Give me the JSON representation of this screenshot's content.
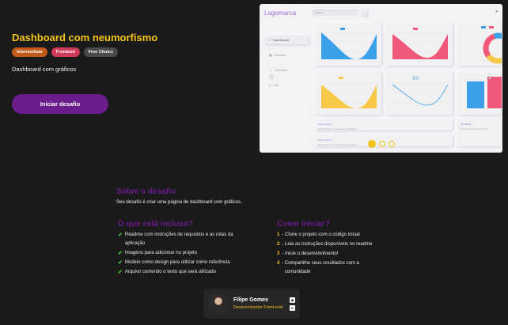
{
  "hero": {
    "title": "Dashboard com neumorfismo",
    "tags": [
      "Intermediate",
      "Frontend",
      "Free Choice"
    ],
    "subtitle": "Dashboard com gráficos",
    "cta_label": "Iniciar desafio"
  },
  "preview": {
    "logo": "Logomarca",
    "search_placeholder": "Search",
    "sidebar": [
      "Dashboard",
      "Produto",
      "Usuários",
      "Fila"
    ],
    "text_cards": [
      {
        "title": "Lorem ipsum",
        "body": "Dolor sit amet consectetur adipiscing"
      },
      {
        "title": "Lorem ipsum",
        "body": "Dolor sit amet consectetur adipiscing"
      },
      {
        "title": "10 000,00",
        "body": "Dolor sit amet consectetur"
      }
    ],
    "carousel_dots": 3,
    "active_dot": 0
  },
  "about": {
    "title": "Sobre o desafio",
    "text": "Seu desafio é criar uma página de dashboard com gráficos."
  },
  "included": {
    "title": "O que está incluso?",
    "items": [
      "Readme com instruções de requisitos e as rotas da aplicação",
      "Imagens para adicionar no projeto",
      "Modelo como design para utilizar como referência",
      "Arquivo contendo o texto que será utilizado"
    ]
  },
  "start": {
    "title": "Como iniciar?",
    "steps": [
      {
        "n": "1",
        "text": "Clone o projeto com o código inicial"
      },
      {
        "n": "2",
        "text": "Leia as instruções disponíveis no readme"
      },
      {
        "n": "3",
        "text": "Inicie o desenvolvimento!"
      },
      {
        "n": "4",
        "text": "Compartilhe seus resultados com a comunidade"
      }
    ]
  },
  "author": {
    "name": "Filipe Gomes",
    "role": "Desenvolvedor Front-end"
  },
  "colors": {
    "accent_yellow": "#f5c518",
    "purple": "#6a1b8c",
    "check_green": "#4ec04e",
    "chart_blue": "#3aa0e8",
    "chart_pink": "#f0587a",
    "chart_yellow": "#f7c948"
  }
}
